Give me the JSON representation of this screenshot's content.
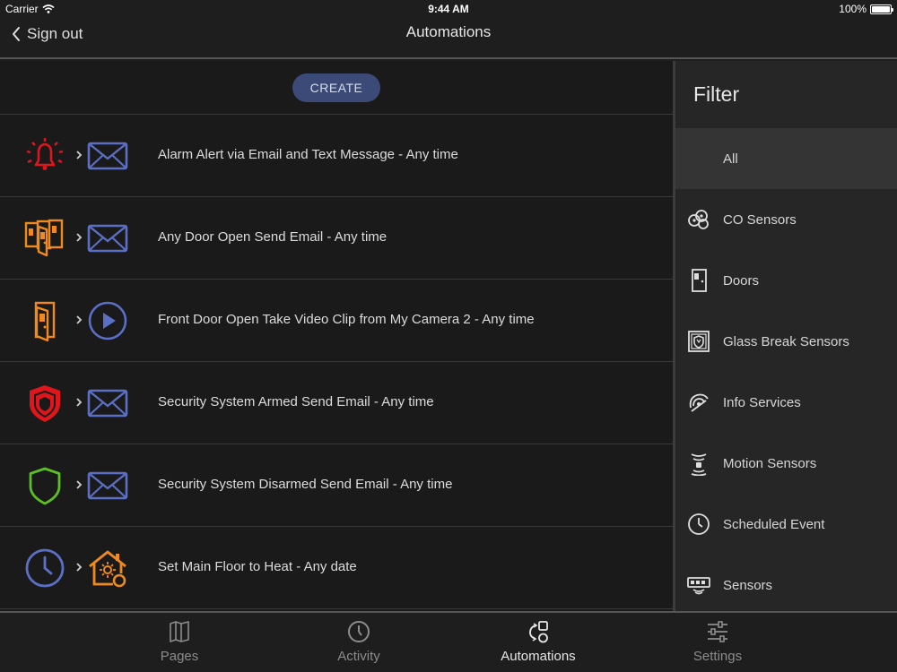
{
  "status_bar": {
    "carrier": "Carrier",
    "time": "9:44 AM",
    "battery": "100%"
  },
  "nav": {
    "back_label": "Sign out",
    "title": "Automations"
  },
  "create_label": "CREATE",
  "automations": [
    {
      "label": "Alarm Alert via Email and Text Message - Any time",
      "trigger_icon": "alarm-bell-icon",
      "action_icon": "email-icon"
    },
    {
      "label": "Any Door Open Send Email - Any time",
      "trigger_icon": "multiple-doors-icon",
      "action_icon": "email-icon"
    },
    {
      "label": "Front Door Open Take Video Clip from My Camera 2 - Any time",
      "trigger_icon": "door-icon",
      "action_icon": "play-video-icon"
    },
    {
      "label": "Security System Armed Send Email - Any time",
      "trigger_icon": "armed-shield-icon",
      "action_icon": "email-icon"
    },
    {
      "label": "Security System Disarmed Send Email - Any time",
      "trigger_icon": "disarmed-shield-icon",
      "action_icon": "email-icon"
    },
    {
      "label": "Set Main Floor to Heat - Any date",
      "trigger_icon": "clock-icon",
      "action_icon": "thermostat-home-icon"
    }
  ],
  "filter": {
    "title": "Filter",
    "items": [
      {
        "label": "All",
        "icon": ""
      },
      {
        "label": "CO Sensors",
        "icon": "co-sensor-icon"
      },
      {
        "label": "Doors",
        "icon": "door-sensor-icon"
      },
      {
        "label": "Glass Break Sensors",
        "icon": "glass-break-icon"
      },
      {
        "label": "Info Services",
        "icon": "info-services-icon"
      },
      {
        "label": "Motion Sensors",
        "icon": "motion-sensor-icon"
      },
      {
        "label": "Scheduled Event",
        "icon": "scheduled-clock-icon"
      },
      {
        "label": "Sensors",
        "icon": "sensors-icon"
      }
    ]
  },
  "tabs": [
    {
      "label": "Pages",
      "icon": "pages-icon"
    },
    {
      "label": "Activity",
      "icon": "activity-clock-icon"
    },
    {
      "label": "Automations",
      "icon": "automations-icon"
    },
    {
      "label": "Settings",
      "icon": "settings-sliders-icon"
    }
  ],
  "colors": {
    "accent_blue": "#5b6fc4",
    "alarm_red": "#e0161c",
    "door_orange": "#f08a1c",
    "disarmed_green": "#5bbf25",
    "create_button": "#3c4a77"
  }
}
